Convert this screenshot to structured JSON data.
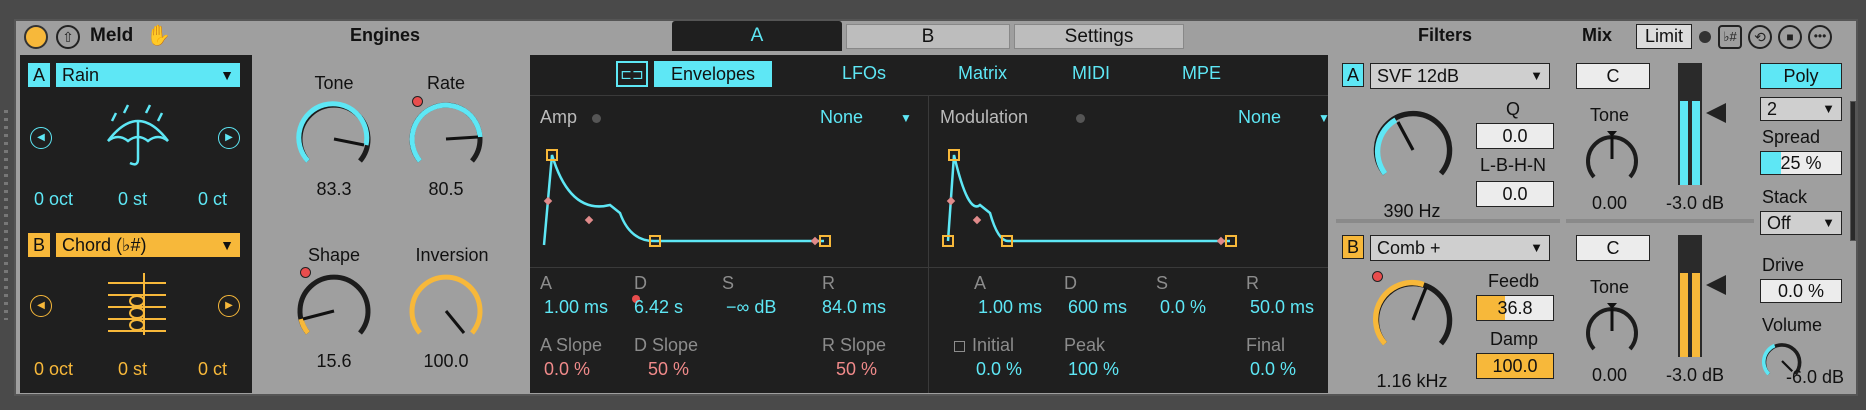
{
  "header": {
    "device_title": "Meld",
    "engines": "Engines",
    "filters": "Filters",
    "mix": "Mix",
    "limit": "Limit"
  },
  "tabs": [
    {
      "label": "A"
    },
    {
      "label": "B"
    },
    {
      "label": "Settings"
    }
  ],
  "osc_a": {
    "badge": "A",
    "preset": "Rain",
    "oct": "0 oct",
    "st": "0 st",
    "ct": "0 ct",
    "tone_label": "Tone",
    "tone": "83.3",
    "rate_label": "Rate",
    "rate": "80.5"
  },
  "osc_b": {
    "badge": "B",
    "preset": "Chord (♭#)",
    "oct": "0 oct",
    "st": "0 st",
    "ct": "0 ct",
    "shape_label": "Shape",
    "shape": "15.6",
    "inversion_label": "Inversion",
    "inversion": "100.0"
  },
  "subtabs": [
    "Envelopes",
    "LFOs",
    "Matrix",
    "MIDI",
    "MPE"
  ],
  "amp": {
    "title": "Amp",
    "target": "None",
    "a_label": "A",
    "a": "1.00 ms",
    "d_label": "D",
    "d": "6.42 s",
    "s_label": "S",
    "s": "−∞ dB",
    "r_label": "R",
    "r": "84.0 ms",
    "aslope_label": "A Slope",
    "aslope": "0.0 %",
    "dslope_label": "D Slope",
    "dslope": "50 %",
    "rslope_label": "R Slope",
    "rslope": "50 %"
  },
  "mod": {
    "title": "Modulation",
    "target": "None",
    "a_label": "A",
    "a": "1.00 ms",
    "d_label": "D",
    "d": "600 ms",
    "s_label": "S",
    "s": "0.0 %",
    "r_label": "R",
    "r": "50.0 ms",
    "initial_label": "Initial",
    "initial": "0.0 %",
    "peak_label": "Peak",
    "peak": "100 %",
    "final_label": "Final",
    "final": "0.0 %"
  },
  "filter_a": {
    "badge": "A",
    "type": "SVF 12dB",
    "freq": "390 Hz",
    "q_label": "Q",
    "q": "0.0",
    "lbhn_label": "L-B-H-N",
    "lbhn": "0.0"
  },
  "filter_b": {
    "badge": "B",
    "type": "Comb +",
    "freq": "1.16 kHz",
    "feedb_label": "Feedb",
    "feedb": "36.8",
    "damp_label": "Damp",
    "damp": "100.0"
  },
  "mix_a": {
    "pan": "C",
    "tone_label": "Tone",
    "tone": "0.00",
    "level": "-3.0 dB"
  },
  "mix_b": {
    "pan": "C",
    "tone_label": "Tone",
    "tone": "0.00",
    "level": "-3.0 dB"
  },
  "global": {
    "poly": "Poly",
    "voices": "2",
    "spread_label": "Spread",
    "spread": "25 %",
    "stack_label": "Stack",
    "stack": "Off",
    "drive_label": "Drive",
    "drive": "0.0 %",
    "volume_label": "Volume",
    "volume": "-6.0 dB"
  },
  "colors": {
    "cyan": "#5ee7f5",
    "yellow": "#f7b83a",
    "panel": "#1f1f1f",
    "device": "#9f9f9f"
  }
}
